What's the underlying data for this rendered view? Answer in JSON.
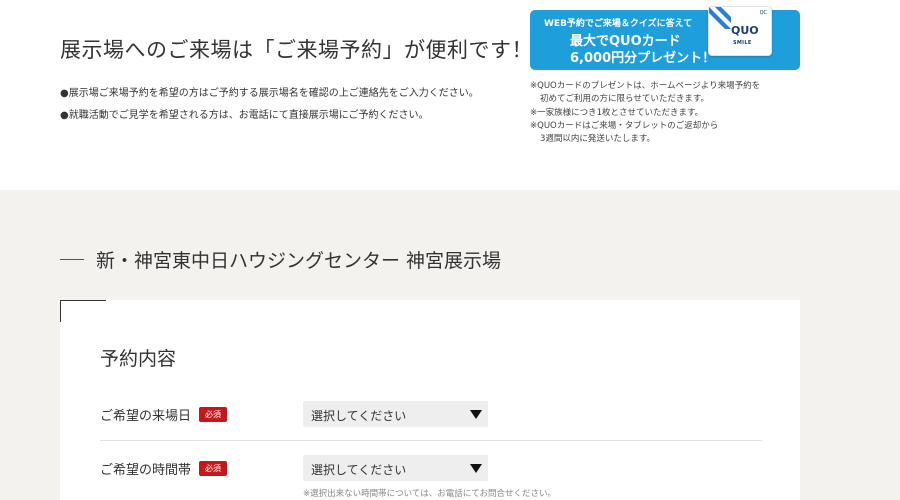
{
  "intro": {
    "headline": "展示場へのご来場は「ご来場予約」が便利です！",
    "notes": [
      "●展示場ご来場予約を希望の方はご予約する展示場名を確認の上ご連絡先をご入力ください。",
      "●就職活動でご見学を希望される方は、お電話にて直接展示場にご予約ください。"
    ]
  },
  "banner": {
    "line1": "WEB予約でご来場＆クイズに答えて",
    "line2": "最大でQUOカード",
    "line3": "6,000円分プレゼント！",
    "card_logo": "QUO",
    "card_sub": "SMILE",
    "card_mark": "QC",
    "bg_color": "#1e9fdc"
  },
  "disclaimers": [
    "※QUOカードのプレゼントは、ホームページより来場予約を",
    "初めてご利用の方に限らせていただきます。",
    "※一家族様につき1枚とさせていただきます。",
    "※QUOカードはご来場・タブレットのご返却から",
    "3週間以内に発送いたします。"
  ],
  "venue": {
    "title": "新・神宮東中日ハウジングセンター 神宮展示場"
  },
  "form": {
    "title": "予約内容",
    "required_badge": "必須",
    "rows": [
      {
        "label": "ご希望の来場日",
        "select_value": "選択してください"
      },
      {
        "label": "ご希望の時間帯",
        "select_value": "選択してください"
      }
    ],
    "time_note": "※選択出来ない時間帯については、お電話にてお問合せください。",
    "badge_color": "#c8161d"
  }
}
